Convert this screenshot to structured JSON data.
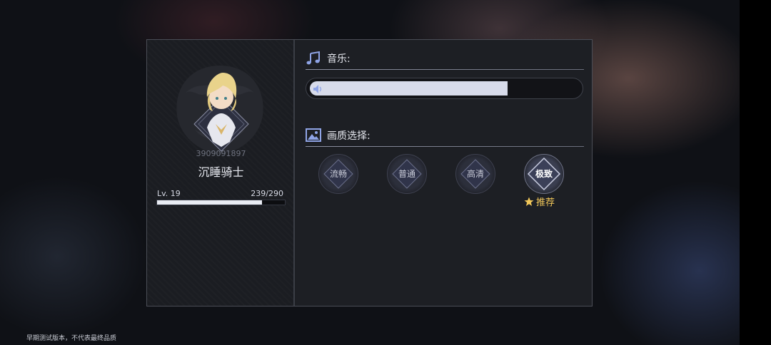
{
  "profile": {
    "uid": "3909091897",
    "nickname": "沉睡骑士",
    "level": "Lv. 19",
    "exp_text": "239/290",
    "exp_progress": 0.824
  },
  "music": {
    "title": "音乐:",
    "icon": "music-note-icon",
    "volume": 0.73
  },
  "quality": {
    "title": "画质选择:",
    "icon": "image-icon",
    "options": [
      "流畅",
      "普通",
      "高清",
      "极致"
    ],
    "selected": "极致",
    "recommend_label": "推荐"
  },
  "footer": {
    "note": "早期测试版本，不代表最终品质"
  },
  "colors": {
    "accent": "#d7dbea",
    "recommend": "#f1c75a",
    "panel": "#1d1f24"
  }
}
